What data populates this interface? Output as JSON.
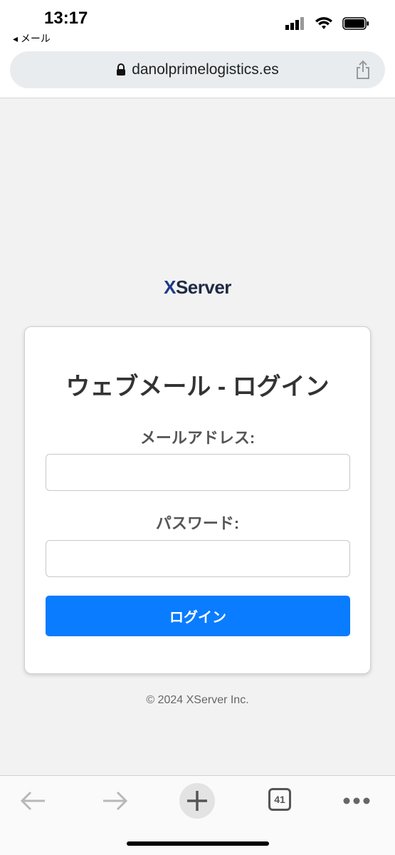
{
  "status": {
    "time": "13:17",
    "back_app": "◂ メール"
  },
  "browser": {
    "url": "danolprimelogistics.es",
    "tabs_count": "41"
  },
  "page": {
    "logo_x": "X",
    "logo_rest": "Server",
    "title": "ウェブメール - ログイン",
    "email_label": "メールアドレス:",
    "email_value": "",
    "password_label": "パスワード:",
    "password_value": "",
    "login_button": "ログイン",
    "footer": "© 2024 XServer Inc."
  },
  "colors": {
    "accent": "#0a7cff",
    "background": "#f2f2f2"
  }
}
